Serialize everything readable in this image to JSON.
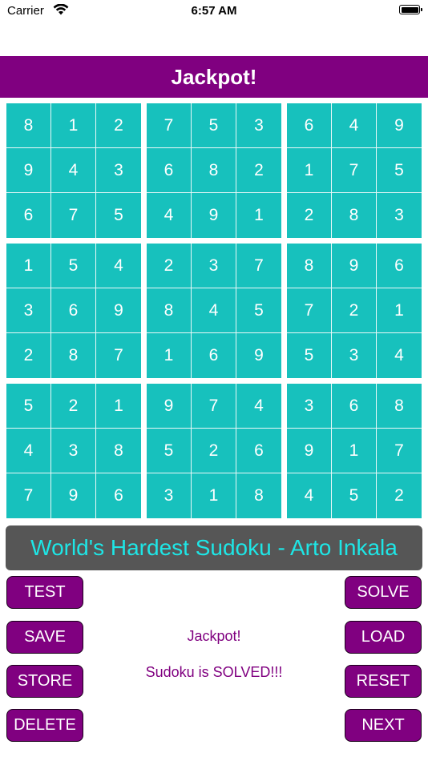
{
  "status_bar": {
    "carrier": "Carrier",
    "time": "6:57 AM"
  },
  "header": {
    "title": "Jackpot!"
  },
  "grid": [
    [
      "8",
      "1",
      "2",
      "7",
      "5",
      "3",
      "6",
      "4",
      "9"
    ],
    [
      "9",
      "4",
      "3",
      "6",
      "8",
      "2",
      "1",
      "7",
      "5"
    ],
    [
      "6",
      "7",
      "5",
      "4",
      "9",
      "1",
      "2",
      "8",
      "3"
    ],
    [
      "1",
      "5",
      "4",
      "2",
      "3",
      "7",
      "8",
      "9",
      "6"
    ],
    [
      "3",
      "6",
      "9",
      "8",
      "4",
      "5",
      "7",
      "2",
      "1"
    ],
    [
      "2",
      "8",
      "7",
      "1",
      "6",
      "9",
      "5",
      "3",
      "4"
    ],
    [
      "5",
      "2",
      "1",
      "9",
      "7",
      "4",
      "3",
      "6",
      "8"
    ],
    [
      "4",
      "3",
      "8",
      "5",
      "2",
      "6",
      "9",
      "1",
      "7"
    ],
    [
      "7",
      "9",
      "6",
      "3",
      "1",
      "8",
      "4",
      "5",
      "2"
    ]
  ],
  "puzzle": {
    "name": "World's Hardest Sudoku - Arto Inkala"
  },
  "buttons": {
    "test": "TEST",
    "solve": "SOLVE",
    "save": "SAVE",
    "load": "LOAD",
    "store": "STORE",
    "reset": "RESET",
    "delete": "DELETE",
    "next": "NEXT"
  },
  "messages": {
    "result": "Jackpot!",
    "status": "Sudoku is SOLVED!!!"
  },
  "colors": {
    "accent": "#800080",
    "cell": "#17c1bd",
    "banner": "#565656",
    "banner_text": "#1ee6e6"
  }
}
